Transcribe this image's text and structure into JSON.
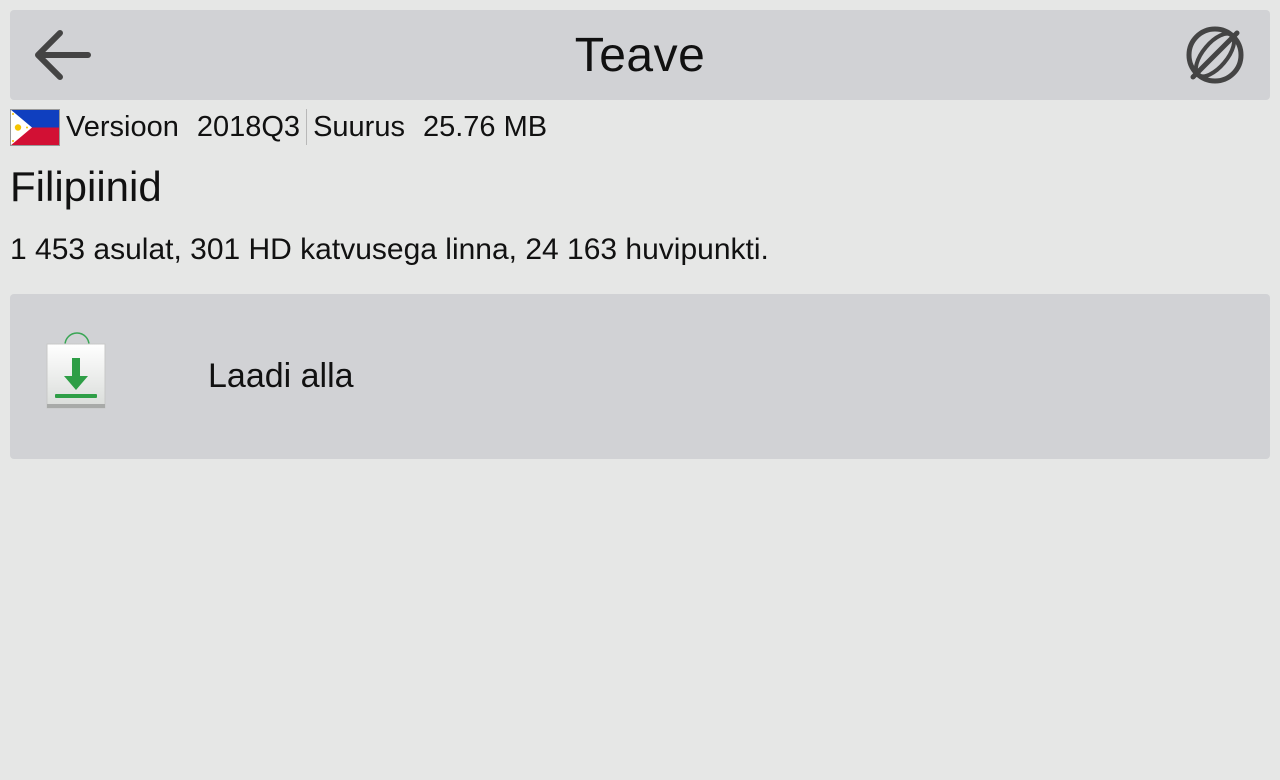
{
  "header": {
    "title": "Teave",
    "back_icon": "arrow-left-icon",
    "right_icon": "globe-crossed-icon"
  },
  "map_info": {
    "flag": "philippines-flag",
    "version_label": "Versioon",
    "version_value": "2018Q3",
    "size_label": "Suurus",
    "size_value": "25.76 MB"
  },
  "country_name": "Filipiinid",
  "stats_text": "1 453 asulat, 301 HD katvusega linna, 24 163 huvipunkti.",
  "download": {
    "label": "Laadi alla",
    "icon": "download-bag-icon"
  },
  "colors": {
    "background": "#e6e7e6",
    "panel": "#d1d2d5",
    "accent_green": "#2e9e46"
  }
}
